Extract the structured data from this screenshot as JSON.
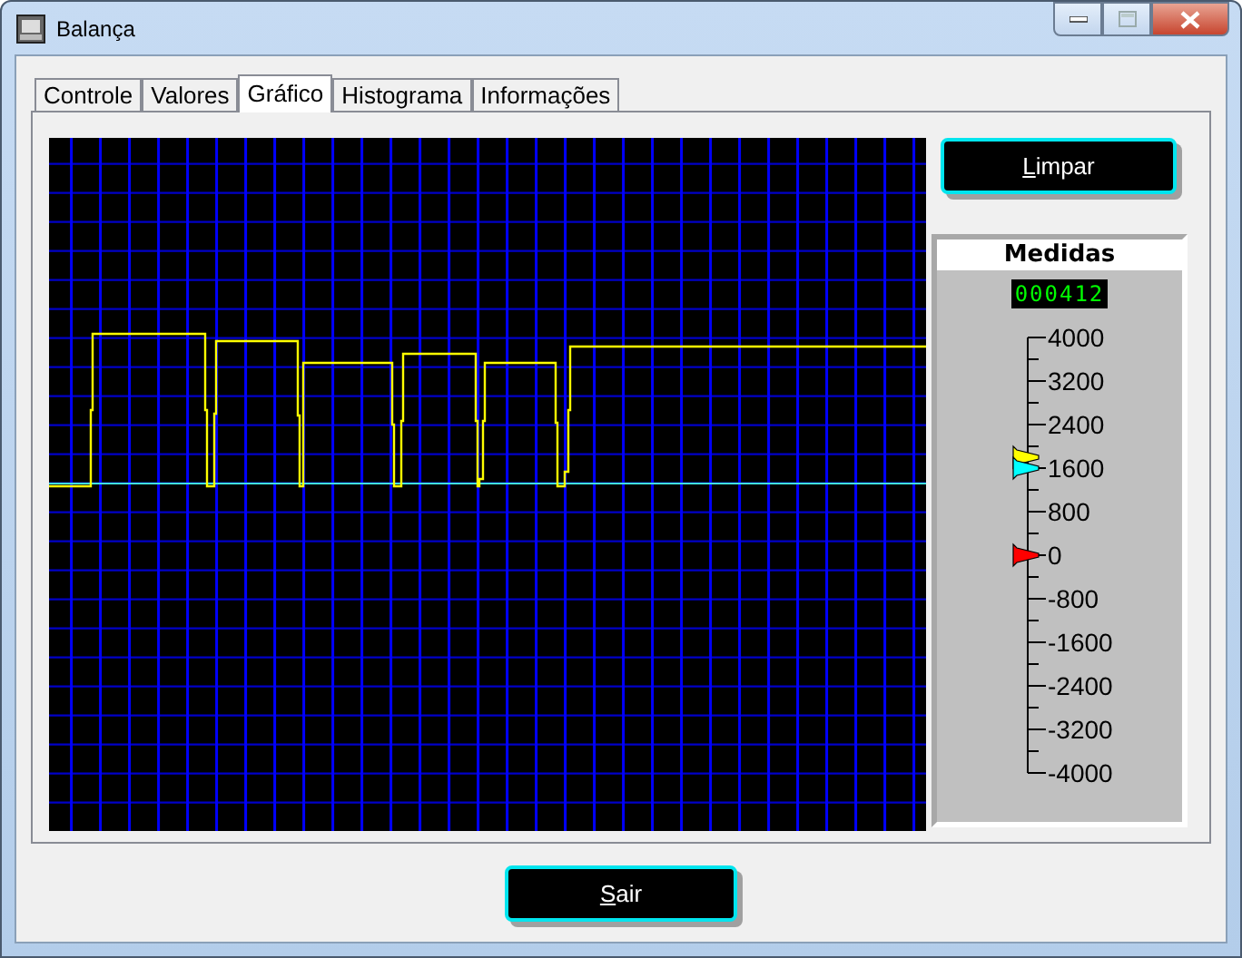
{
  "window": {
    "title": "Balança"
  },
  "tabs": [
    {
      "label": "Controle",
      "selected": false
    },
    {
      "label": "Valores",
      "selected": false
    },
    {
      "label": "Gráfico",
      "selected": true
    },
    {
      "label": "Histograma",
      "selected": false
    },
    {
      "label": "Informações",
      "selected": false
    }
  ],
  "clear_button": "Limpar",
  "measures": {
    "title": "Medidas",
    "display": "000412",
    "scale_labels": [
      "4000",
      "3200",
      "2400",
      "1600",
      "800",
      "0",
      "-800",
      "-1600",
      "-2400",
      "-3200",
      "-4000"
    ],
    "markers": [
      {
        "color": "#ffff00",
        "level": 0.725
      },
      {
        "color": "#00ffff",
        "level": 0.7
      },
      {
        "color": "#ff0000",
        "level": 0.5
      }
    ]
  },
  "exit_button": "Sair"
}
